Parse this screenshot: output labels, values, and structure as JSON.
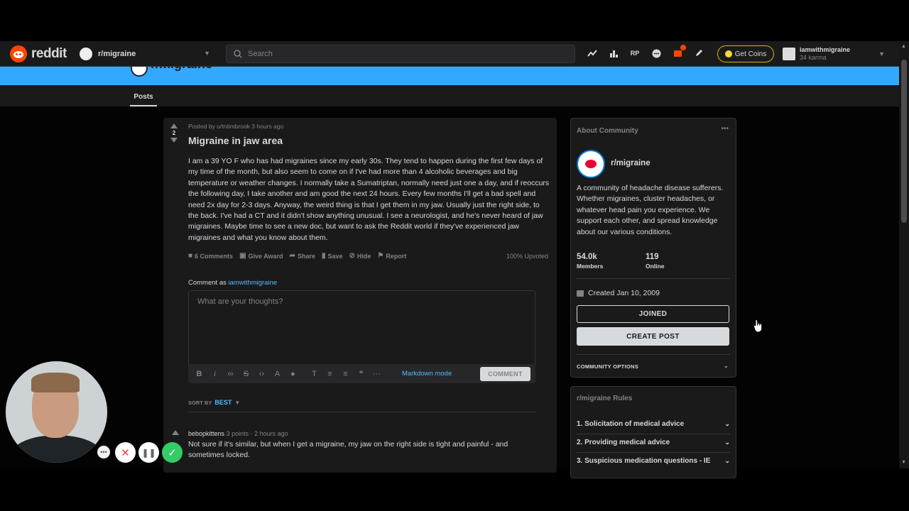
{
  "header": {
    "logo_text": "reddit",
    "subreddit": "r/migraine",
    "search_placeholder": "Search",
    "coins_label": "Get Coins",
    "username": "iamwithmigraine",
    "karma": "34 karma"
  },
  "tabs": {
    "posts": "Posts"
  },
  "post": {
    "score": "2",
    "meta": "Posted by u/tntimbrook 3 hours ago",
    "title": "Migraine in jaw area",
    "body": "I am a 39 YO F who has had migraines since my early 30s. They tend to happen during the first few days of my time of the month, but also seem to come on if I've had more than 4 alcoholic beverages and big temperature or weather changes. I normally take a Sumatriptan, normally need just one a day, and if reoccurs the following day, I take another and am good the next 24 hours. Every few months I'll get a bad spell and need 2x day for 2-3 days. Anyway, the weird thing is that I get them in my jaw. Usually just the right side, to the back. I've had a CT and it didn't show anything unusual. I see a neurologist, and he's never heard of jaw migraines. Maybe time to see a new doc, but want to ask the Reddit world if they've experienced jaw migraines and what you know about them.",
    "actions": {
      "comments": "6 Comments",
      "award": "Give Award",
      "share": "Share",
      "save": "Save",
      "hide": "Hide",
      "report": "Report"
    },
    "upvoted": "100% Upvoted"
  },
  "comment_form": {
    "comment_as": "Comment as",
    "user": "iamwithmigraine",
    "placeholder": "What are your thoughts?",
    "markdown_mode": "Markdown mode",
    "submit": "COMMENT"
  },
  "sort": {
    "label": "SORT BY",
    "value": "BEST"
  },
  "comments": [
    {
      "author": "bebopkittens",
      "meta": "3 points · 2 hours ago",
      "text": "Not sure if it's similar, but when I get a migraine, my jaw on the right side is tight and painful - and sometimes locked."
    }
  ],
  "about": {
    "heading": "About Community",
    "name": "r/migraine",
    "description": "A community of headache disease sufferers. Whether migraines, cluster headaches, or whatever head pain you experience. We support each other, and spread knowledge about our various conditions.",
    "members_value": "54.0k",
    "members_label": "Members",
    "online_value": "119",
    "online_label": "Online",
    "created": "Created Jan 10, 2009",
    "joined": "JOINED",
    "create_post": "CREATE POST",
    "options": "COMMUNITY OPTIONS"
  },
  "rules": {
    "heading": "r/migraine Rules",
    "items": [
      "1. Solicitation of medical advice",
      "2. Providing medical advice",
      "3. Suspicious medication questions - IE"
    ]
  },
  "colors": {
    "accent": "#4fbcff",
    "banner": "#33a8ff",
    "brand": "#ff4500"
  }
}
